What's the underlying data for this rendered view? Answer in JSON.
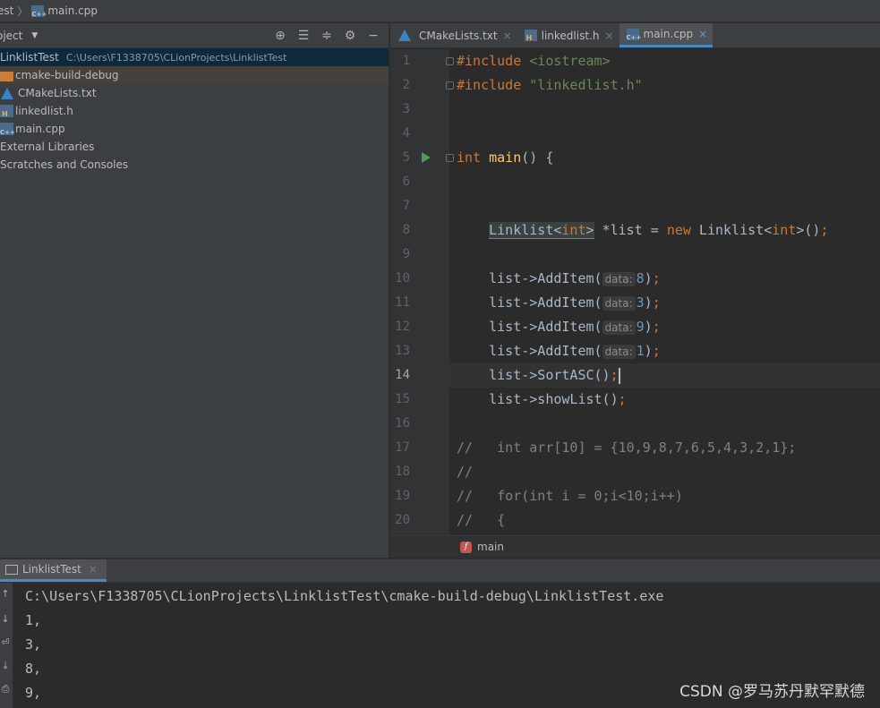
{
  "breadcrumb": {
    "project": "est",
    "file": "main.cpp"
  },
  "project_panel": {
    "title": "oject",
    "root": {
      "name": "LinklistTest",
      "path": "C:\\Users\\F1338705\\CLionProjects\\LinklistTest"
    },
    "items": [
      {
        "name": "cmake-build-debug",
        "icon": "folder-icon"
      },
      {
        "name": "CMakeLists.txt",
        "icon": "cmake-icon"
      },
      {
        "name": "linkedlist.h",
        "icon": "header-file-icon"
      },
      {
        "name": "main.cpp",
        "icon": "cpp-file-icon"
      },
      {
        "name": "External Libraries",
        "icon": "library-icon"
      },
      {
        "name": "Scratches and Consoles",
        "icon": "scratches-icon"
      }
    ],
    "tools": [
      "locate-icon",
      "expand-all-icon",
      "collapse-all-icon",
      "gear-icon",
      "hide-icon"
    ]
  },
  "tabs": [
    {
      "label": "CMakeLists.txt",
      "icon": "cmake-icon",
      "close": "×"
    },
    {
      "label": "linkedlist.h",
      "icon": "header-file-icon",
      "close": "×"
    },
    {
      "label": "main.cpp",
      "icon": "cpp-file-icon",
      "close": "×",
      "active": true
    }
  ],
  "editor": {
    "line_numbers": [
      "1",
      "2",
      "3",
      "4",
      "5",
      "6",
      "7",
      "8",
      "9",
      "10",
      "11",
      "12",
      "13",
      "14",
      "15",
      "16",
      "17",
      "18",
      "19",
      "20"
    ],
    "current_line": "14",
    "code": {
      "l1_directive": "#include",
      "l1_header": "<iostream>",
      "l2_directive": "#include",
      "l2_header": "\"linkedlist.h\"",
      "l5_type": "int",
      "l5_name": "main",
      "l5_rest": "() {",
      "l8_class": "Linklist",
      "l8_tpl_open": "<",
      "l8_tpl_type": "int",
      "l8_tpl_close": ">",
      "l8_var": " *list = ",
      "l8_new": "new",
      "l8_class2": " Linklist",
      "l8_tpl2_open": "<",
      "l8_tpl2_type": "int",
      "l8_tpl2_close": ">",
      "l8_end": "()",
      "l8_semi": ";",
      "call_prefix": "list->AddItem(",
      "hint_label": "data:",
      "additem_values": [
        "8",
        "3",
        "9",
        "1"
      ],
      "call_suffix": ")",
      "semi": ";",
      "l14_call": "list->SortASC()",
      "l15_call": "list->showList()",
      "l17": "//   int arr[10] = {10,9,8,7,6,5,4,3,2,1};",
      "l18": "//",
      "l19": "//   for(int i = 0;i<10;i++)",
      "l20": "//   {"
    }
  },
  "structure": {
    "function": "main",
    "icon_letter": "f"
  },
  "run_panel": {
    "tab_label": "LinklistTest",
    "tab_close": "×",
    "output": [
      "C:\\Users\\F1338705\\CLionProjects\\LinklistTest\\cmake-build-debug\\LinklistTest.exe",
      "1,",
      "3,",
      "8,",
      "9,"
    ]
  },
  "watermark": "CSDN @罗马苏丹默罕默德",
  "colors": {
    "keyword": "#cc7832",
    "string": "#6a8759",
    "number": "#6897bb",
    "function": "#ffc66d",
    "accent": "#4a88c7"
  }
}
